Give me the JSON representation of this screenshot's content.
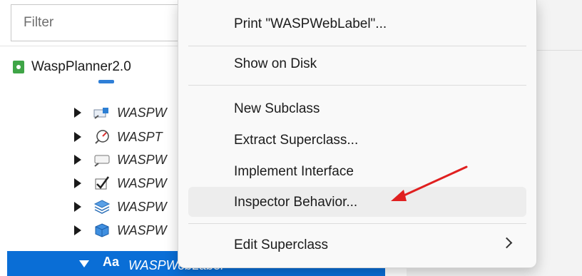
{
  "navigator": {
    "filter_placeholder": "Filter",
    "project_name": "WaspPlanner2.0",
    "rows": [
      {
        "label": "WASPW",
        "icon": "form-window-icon"
      },
      {
        "label": "WASPT",
        "icon": "gauge-icon"
      },
      {
        "label": "WASPW",
        "icon": "textfield-icon"
      },
      {
        "label": "WASPW",
        "icon": "checkbox-icon"
      },
      {
        "label": "WASPW",
        "icon": "stack-icon"
      },
      {
        "label": "WASPW",
        "icon": "cube-icon"
      }
    ],
    "selected_row": {
      "label": "WASPWebLabel",
      "icon_text": "Aa"
    }
  },
  "context_menu": {
    "items": [
      {
        "label": "Print \"WASPWebLabel\"..."
      },
      {
        "label": "Show on Disk"
      },
      {
        "label": "New Subclass"
      },
      {
        "label": "Extract Superclass..."
      },
      {
        "label": "Implement Interface"
      },
      {
        "label": "Inspector Behavior..."
      },
      {
        "label": "Edit Superclass"
      }
    ],
    "hovered_item": "Inspector Behavior..."
  },
  "colors": {
    "selection": "#0a6ed6",
    "annotation_arrow": "#e02020",
    "project_icon": "#3fa547"
  }
}
